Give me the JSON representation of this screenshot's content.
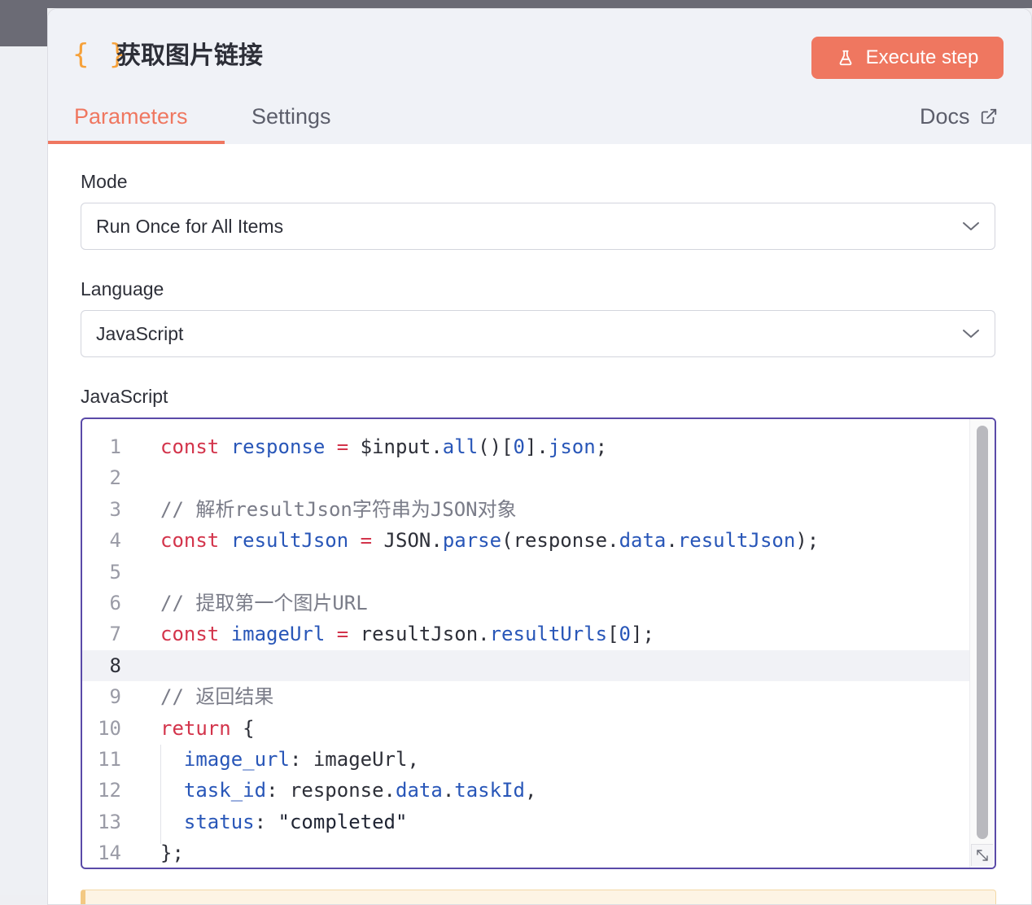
{
  "node": {
    "icon": "{ }",
    "title": "获取图片链接",
    "execute_label": "Execute step"
  },
  "tabs": [
    {
      "label": "Parameters",
      "active": true
    },
    {
      "label": "Settings",
      "active": false
    }
  ],
  "docs_label": "Docs",
  "fields": {
    "mode": {
      "label": "Mode",
      "value": "Run Once for All Items"
    },
    "language": {
      "label": "Language",
      "value": "JavaScript"
    },
    "code_label": "JavaScript"
  },
  "code_lines": [
    {
      "n": "1",
      "tokens": [
        [
          "k",
          "const"
        ],
        [
          "p",
          " "
        ],
        [
          "v",
          "response"
        ],
        [
          "p",
          " "
        ],
        [
          "k",
          "="
        ],
        [
          "p",
          " $input."
        ],
        [
          "v",
          "all"
        ],
        [
          "p",
          "()["
        ],
        [
          "v",
          "0"
        ],
        [
          "p",
          "]."
        ],
        [
          "v",
          "json"
        ],
        [
          "p",
          ";"
        ]
      ]
    },
    {
      "n": "2",
      "tokens": []
    },
    {
      "n": "3",
      "tokens": [
        [
          "c",
          "// 解析resultJson字符串为JSON对象"
        ]
      ]
    },
    {
      "n": "4",
      "tokens": [
        [
          "k",
          "const"
        ],
        [
          "p",
          " "
        ],
        [
          "v",
          "resultJson"
        ],
        [
          "p",
          " "
        ],
        [
          "k",
          "="
        ],
        [
          "p",
          " JSON."
        ],
        [
          "v",
          "parse"
        ],
        [
          "p",
          "(response."
        ],
        [
          "v",
          "data"
        ],
        [
          "p",
          "."
        ],
        [
          "v",
          "resultJson"
        ],
        [
          "p",
          ");"
        ]
      ]
    },
    {
      "n": "5",
      "tokens": []
    },
    {
      "n": "6",
      "tokens": [
        [
          "c",
          "// 提取第一个图片URL"
        ]
      ]
    },
    {
      "n": "7",
      "tokens": [
        [
          "k",
          "const"
        ],
        [
          "p",
          " "
        ],
        [
          "v",
          "imageUrl"
        ],
        [
          "p",
          " "
        ],
        [
          "k",
          "="
        ],
        [
          "p",
          " resultJson."
        ],
        [
          "v",
          "resultUrls"
        ],
        [
          "p",
          "["
        ],
        [
          "v",
          "0"
        ],
        [
          "p",
          "];"
        ]
      ]
    },
    {
      "n": "8",
      "tokens": [],
      "active": true
    },
    {
      "n": "9",
      "tokens": [
        [
          "c",
          "// 返回结果"
        ]
      ]
    },
    {
      "n": "10",
      "tokens": [
        [
          "k",
          "return"
        ],
        [
          "p",
          " {"
        ]
      ]
    },
    {
      "n": "11",
      "tokens": [
        [
          "p",
          "  "
        ],
        [
          "v",
          "image_url"
        ],
        [
          "p",
          ": imageUrl,"
        ]
      ]
    },
    {
      "n": "12",
      "tokens": [
        [
          "p",
          "  "
        ],
        [
          "v",
          "task_id"
        ],
        [
          "p",
          ": response."
        ],
        [
          "v",
          "data"
        ],
        [
          "p",
          "."
        ],
        [
          "v",
          "taskId"
        ],
        [
          "p",
          ","
        ]
      ]
    },
    {
      "n": "13",
      "tokens": [
        [
          "p",
          "  "
        ],
        [
          "v",
          "status"
        ],
        [
          "p",
          ": "
        ],
        [
          "s",
          "\"completed\""
        ]
      ]
    },
    {
      "n": "14",
      "tokens": [
        [
          "p",
          "};"
        ]
      ]
    }
  ],
  "colors": {
    "accent": "#ef7760",
    "icon": "#f6a13a",
    "editor_border": "#5a4aa8",
    "keyword": "#d3344b",
    "identifier": "#2856b8",
    "comment": "#7a7c88"
  },
  "icons": {
    "execute": "flask-icon",
    "docs": "external-link-icon",
    "select": "chevron-down-icon",
    "resize": "resize-icon"
  }
}
